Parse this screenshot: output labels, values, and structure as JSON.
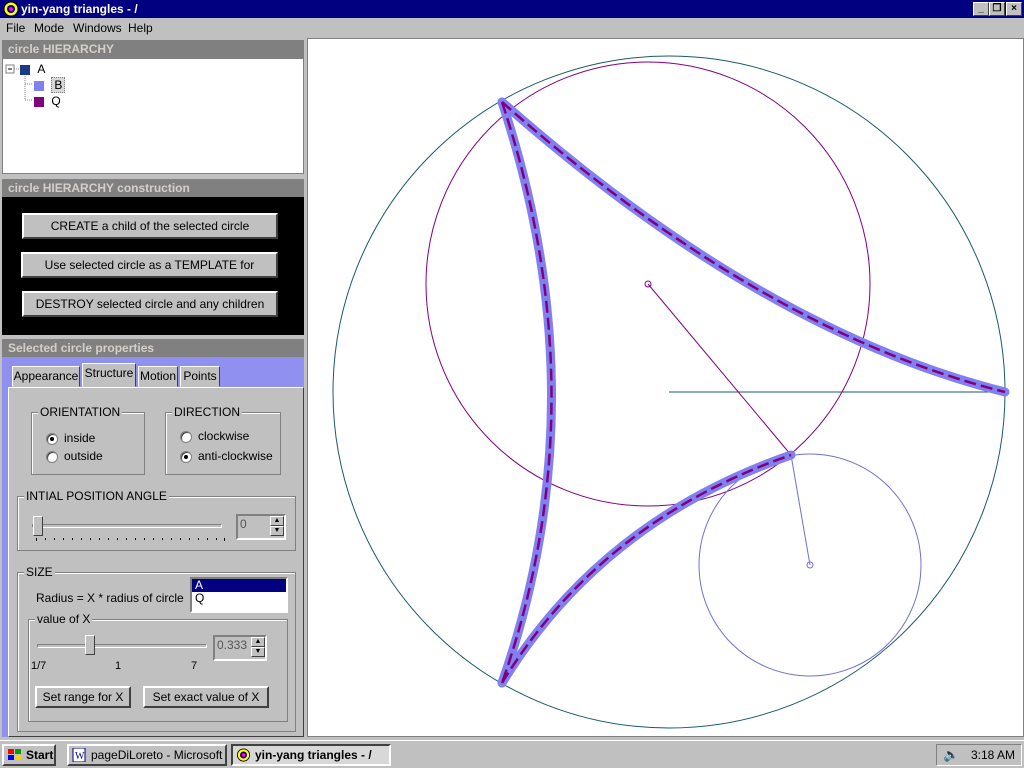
{
  "window": {
    "title": "yin-yang triangles - /",
    "controls": [
      "_",
      "❐",
      "×"
    ]
  },
  "menu": [
    "File",
    "Mode",
    "Windows",
    "Help"
  ],
  "hierarchy": {
    "header": "circle HIERARCHY",
    "items": [
      {
        "label": "A",
        "color": "#1a3a8a"
      },
      {
        "label": "B",
        "color": "#8080f0"
      },
      {
        "label": "Q",
        "color": "#800080"
      }
    ]
  },
  "construction": {
    "header": "circle HIERARCHY construction",
    "buttons": [
      "CREATE  a child of the selected circle",
      "Use selected circle as a TEMPLATE for creation",
      "DESTROY selected circle and any children"
    ]
  },
  "properties": {
    "header": "Selected circle properties",
    "tabs": [
      "Appearance",
      "Structure",
      "Motion",
      "Points"
    ],
    "active_tab": "Structure",
    "orientation": {
      "label": "ORIENTATION",
      "options": [
        "inside",
        "outside"
      ],
      "selected": "inside"
    },
    "direction": {
      "label": "DIRECTION",
      "options": [
        "clockwise",
        "anti-clockwise"
      ],
      "selected": "anti-clockwise"
    },
    "initial_angle": {
      "label": "INTIAL  POSITION  ANGLE",
      "value": "0",
      "slider_fraction": 0.0
    },
    "size": {
      "label": "SIZE",
      "radius_text": "Radius  =  X * radius  of circle",
      "list": [
        "A",
        "Q"
      ],
      "list_selected": "A",
      "x_label": "value of X",
      "x_value": "0.333",
      "ticks": [
        "1/7",
        "1",
        "7"
      ],
      "set_range": "Set range for  X",
      "set_exact": "Set exact value of X"
    }
  },
  "taskbar": {
    "start": "Start",
    "tasks": [
      "pageDiLoreto - Microsoft ...",
      "yin-yang triangles - /"
    ],
    "clock": "3:18 AM"
  },
  "colors": {
    "outer_circle": "#1a5a6a",
    "purple": "#800080",
    "blue_trace": "#8080f0",
    "small_circle": "#7070d0"
  }
}
